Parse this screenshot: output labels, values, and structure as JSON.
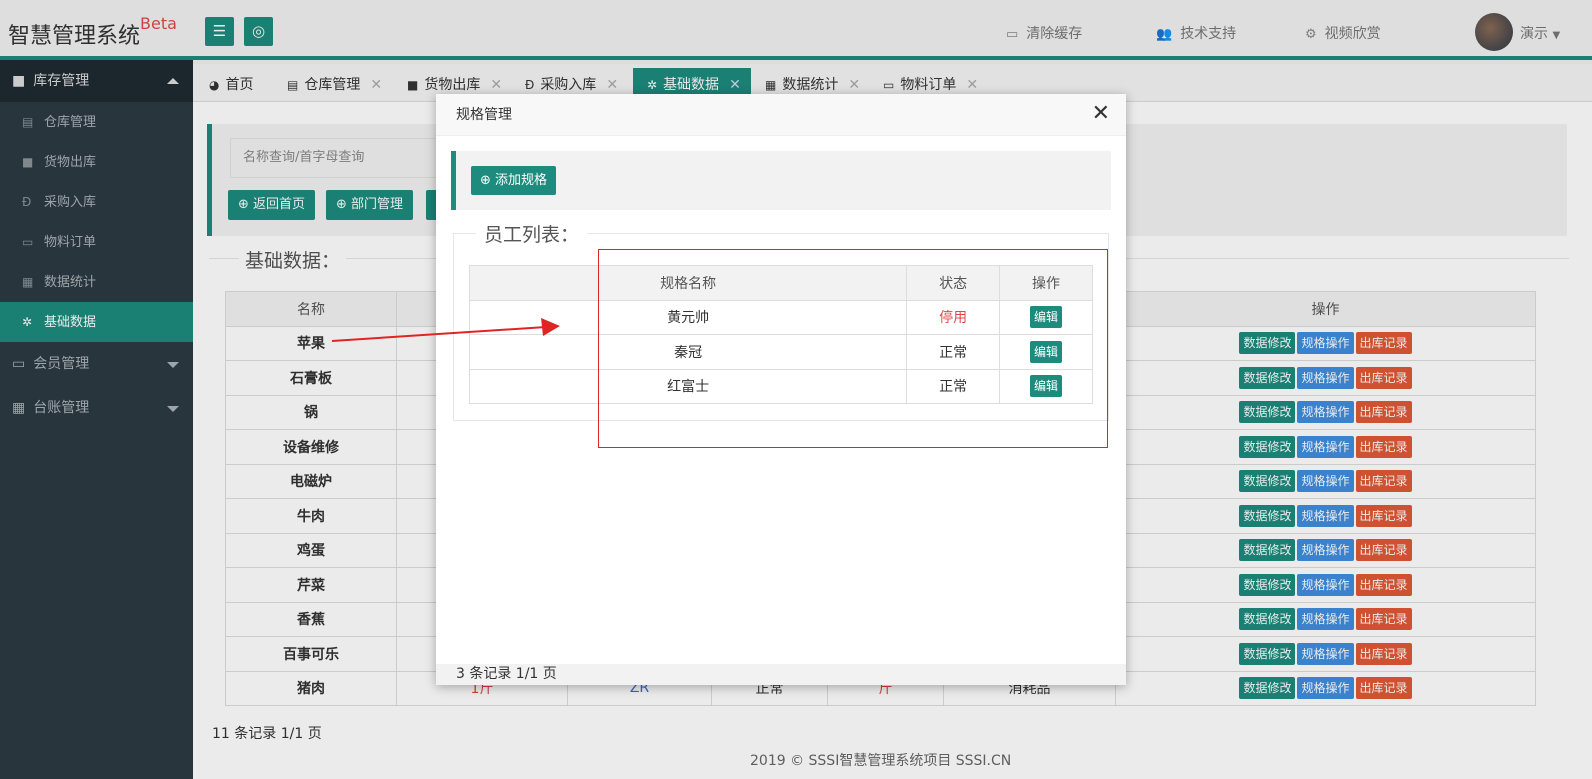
{
  "header": {
    "brand": "智慧管理系统",
    "brand_badge": "Beta",
    "menu_icon": "hamburger-icon",
    "globe_icon": "globe-icon",
    "links": [
      {
        "label": "清除缓存",
        "icon": "monitor-icon"
      },
      {
        "label": "技术支持",
        "icon": "users-icon"
      },
      {
        "label": "视频欣赏",
        "icon": "gears-icon"
      }
    ],
    "user": "演示"
  },
  "sidebar": {
    "group_open": "库存管理",
    "items": [
      {
        "label": "仓库管理",
        "icon": "document-icon"
      },
      {
        "label": "货物出库",
        "icon": "folder-icon"
      },
      {
        "label": "采购入库",
        "icon": "currency-icon"
      },
      {
        "label": "物料订单",
        "icon": "laptop-icon"
      },
      {
        "label": "数据统计",
        "icon": "grid-icon"
      },
      {
        "label": "基础数据",
        "icon": "gear-icon"
      }
    ],
    "groups": [
      {
        "label": "会员管理",
        "icon": "card-icon"
      },
      {
        "label": "台账管理",
        "icon": "grid-icon"
      }
    ]
  },
  "tabs": [
    {
      "label": "首页",
      "icon": "dashboard-icon"
    },
    {
      "label": "仓库管理",
      "icon": "document-icon"
    },
    {
      "label": "货物出库",
      "icon": "folder-icon"
    },
    {
      "label": "采购入库",
      "icon": "currency-icon"
    },
    {
      "label": "基础数据",
      "icon": "gear-icon"
    },
    {
      "label": "数据统计",
      "icon": "grid-icon"
    },
    {
      "label": "物料订单",
      "icon": "laptop-icon"
    }
  ],
  "main": {
    "search_placeholder": "名称查询/首字母查询",
    "buttons": [
      "返回首页",
      "部门管理"
    ],
    "section_title": "基础数据：",
    "table_header_name": "名称",
    "table_header_ops": "操作",
    "rows": [
      "苹果",
      "石膏板",
      "锅",
      "设备维修",
      "电磁炉",
      "牛肉",
      "鸡蛋",
      "芹菜",
      "香蕉",
      "百事可乐",
      "猪肉"
    ],
    "row_buttons": [
      "数据修改",
      "规格操作",
      "出库记录"
    ],
    "partial_last_row": {
      "c1": "1斤",
      "c2": "ZR",
      "c3": "正常",
      "c4": "斤",
      "c5": "消耗品"
    },
    "record_count": "11 条记录 1/1 页",
    "copyright": "2019 ©   SSSI智慧管理系统项目   SSSI.CN"
  },
  "modal": {
    "title": "规格管理",
    "add_button": "添加规格",
    "legend": "员工列表：",
    "columns": [
      "规格名称",
      "状态",
      "操作"
    ],
    "rows": [
      {
        "name": "黄元帅",
        "status": "停用",
        "action": "编辑"
      },
      {
        "name": "秦冠",
        "status": "正常",
        "action": "编辑"
      },
      {
        "name": "红富士",
        "status": "正常",
        "action": "编辑"
      }
    ],
    "record_count": "3 条记录 1/1 页"
  },
  "colors": {
    "accent": "#1d8b7e",
    "disabled_status": "#e04848",
    "annotation": "#e02424"
  }
}
